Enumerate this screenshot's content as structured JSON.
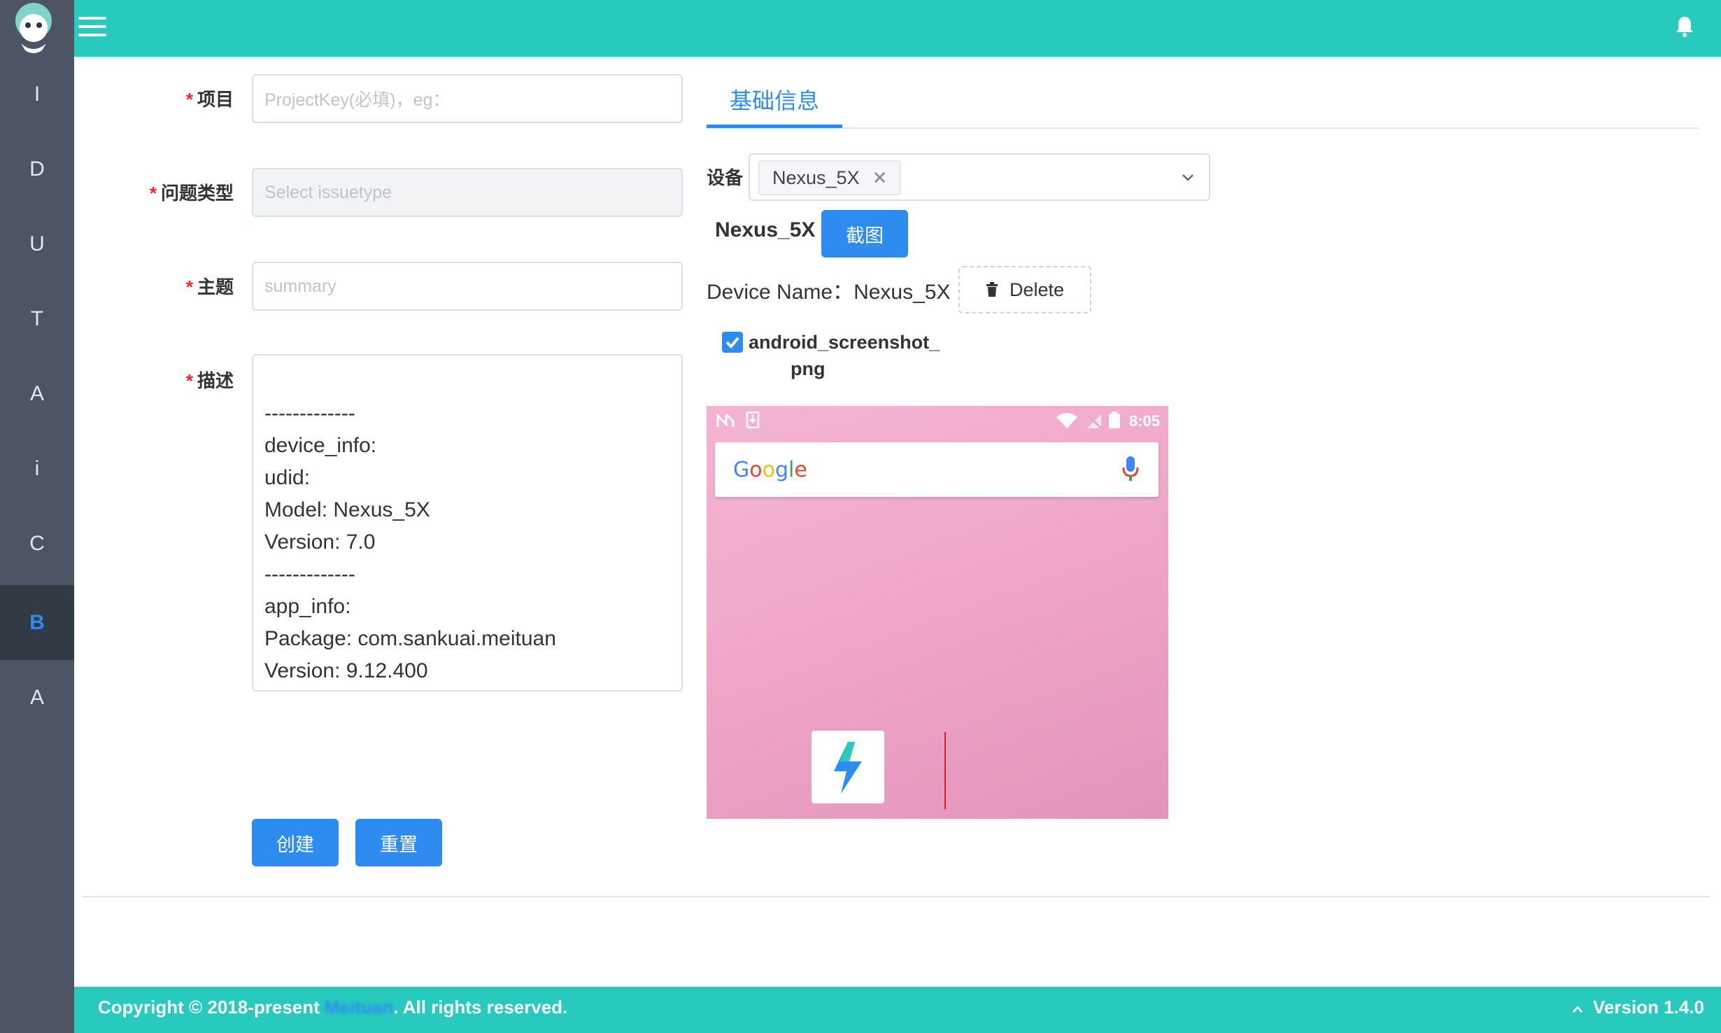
{
  "header": {
    "menu_icon": "hamburger-icon",
    "bell_icon": "bell-icon"
  },
  "sidebar": {
    "items": [
      {
        "label": "I"
      },
      {
        "label": "D"
      },
      {
        "label": "U"
      },
      {
        "label": "T"
      },
      {
        "label": "A"
      },
      {
        "label": "i"
      },
      {
        "label": "C"
      },
      {
        "label": "B"
      },
      {
        "label": "A"
      }
    ],
    "active_index": 7
  },
  "form": {
    "project_label": "项目",
    "project_placeholder": "ProjectKey(必填)，eg：",
    "issuetype_label": "问题类型",
    "issuetype_placeholder": "Select issuetype",
    "summary_label": "主题",
    "summary_placeholder": "summary",
    "desc_label": "描述",
    "desc_lines": [
      "",
      "-------------",
      "device_info:",
      "udid:",
      "Model: Nexus_5X",
      "Version: 7.0",
      "-------------",
      "app_info:",
      "Package: com.sankuai.meituan",
      "Version: 9.12.400"
    ],
    "create_button": "创建",
    "reset_button": "重置",
    "required_mark": "*"
  },
  "right": {
    "tab_label": "基础信息",
    "device_label": "设备",
    "device_tag": "Nexus_5X",
    "device_heading": "Nexus_5X",
    "screenshot_button": "截图",
    "device_name_label": "Device Name：",
    "device_name_value": "Nexus_5X",
    "delete_button": "Delete",
    "file_name_line1": "android_screenshot_",
    "file_name_line2": "png",
    "phone_time": "8:05"
  },
  "footer": {
    "copyright_prefix": "Copyright © 2018-present ",
    "company": "Meituan",
    "copyright_suffix": ". All rights reserved.",
    "version": "Version 1.4.0"
  },
  "colors": {
    "primary": "#2e8cf0",
    "header": "#27cabc",
    "sidebar": "#4d5564",
    "sidebar_active": "#323a46",
    "required": "#f5222d"
  }
}
